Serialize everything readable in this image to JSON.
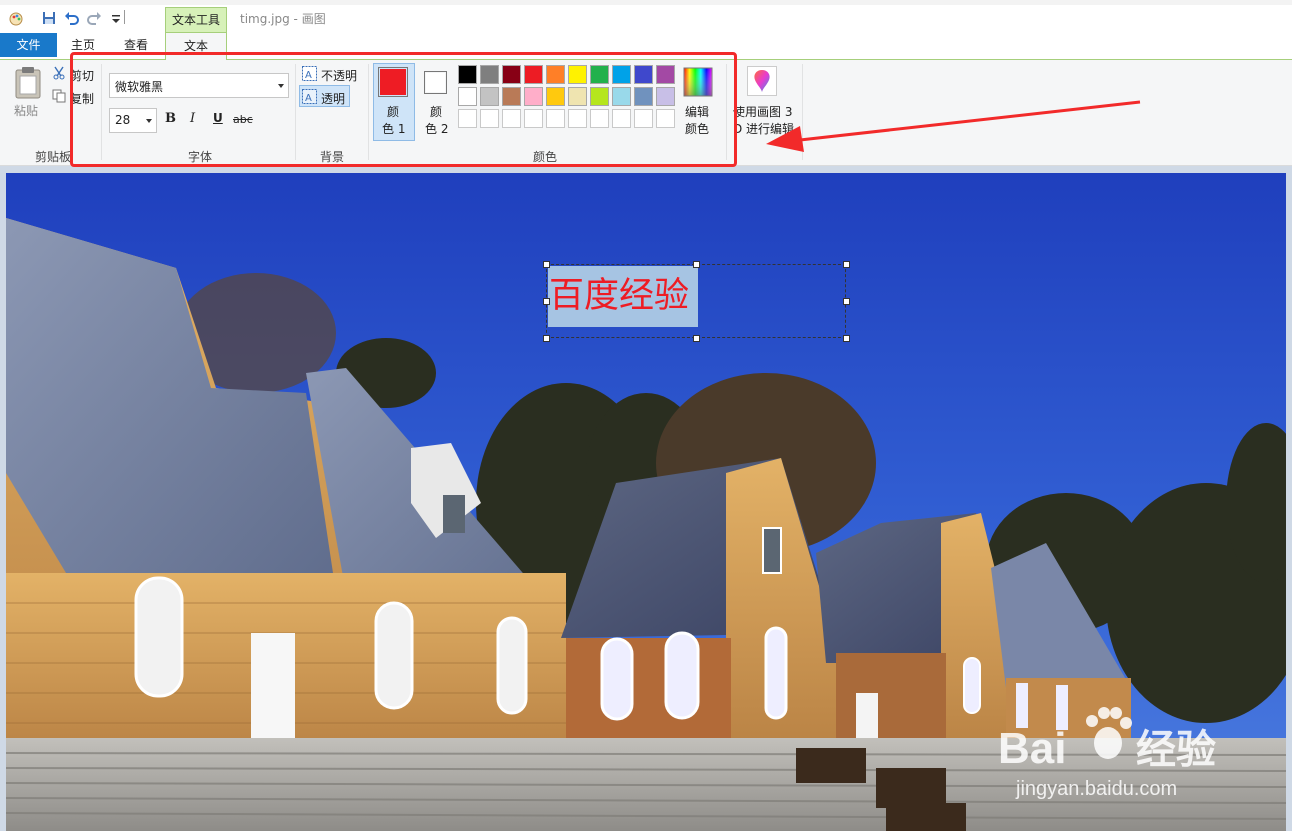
{
  "titlebar": {
    "context_group_label": "文本工具",
    "document_title": "timg.jpg - 画图"
  },
  "tabs": {
    "file": "文件",
    "home": "主页",
    "view": "查看",
    "text": "文本"
  },
  "clipboard": {
    "paste": "粘贴",
    "cut": "剪切",
    "copy": "复制",
    "group_label": "剪贴板"
  },
  "font": {
    "family": "微软雅黑",
    "size": "28",
    "bold": "B",
    "italic": "I",
    "underline": "U",
    "strikethrough": "abc",
    "group_label": "字体"
  },
  "background": {
    "opaque": "不透明",
    "transparent": "透明",
    "group_label": "背景"
  },
  "colors": {
    "color1_line1": "颜",
    "color1_line2": "色 1",
    "color2_line1": "颜",
    "color2_line2": "色 2",
    "color1_value": "#ee1c24",
    "color2_value": "#ffffff",
    "edit_line1": "编辑",
    "edit_line2": "颜色",
    "group_label": "颜色",
    "palette_row1": [
      "#000000",
      "#7f7f7f",
      "#880015",
      "#ed1c24",
      "#ff7f27",
      "#fff200",
      "#22b14c",
      "#00a2e8",
      "#3f48cc",
      "#a349a4"
    ],
    "palette_row2": [
      "#ffffff",
      "#c3c3c3",
      "#b97a57",
      "#ffaec9",
      "#ffc90e",
      "#efe4b0",
      "#b5e61d",
      "#99d9ea",
      "#7092be",
      "#c8bfe7"
    ]
  },
  "paint3d": {
    "line1": "使用画图 3",
    "line2": "D 进行编辑"
  },
  "canvas": {
    "text_content": "百度经验"
  },
  "watermark": {
    "brand": "Bai",
    "brand_cn": "经验",
    "url": "jingyan.baidu.com"
  }
}
